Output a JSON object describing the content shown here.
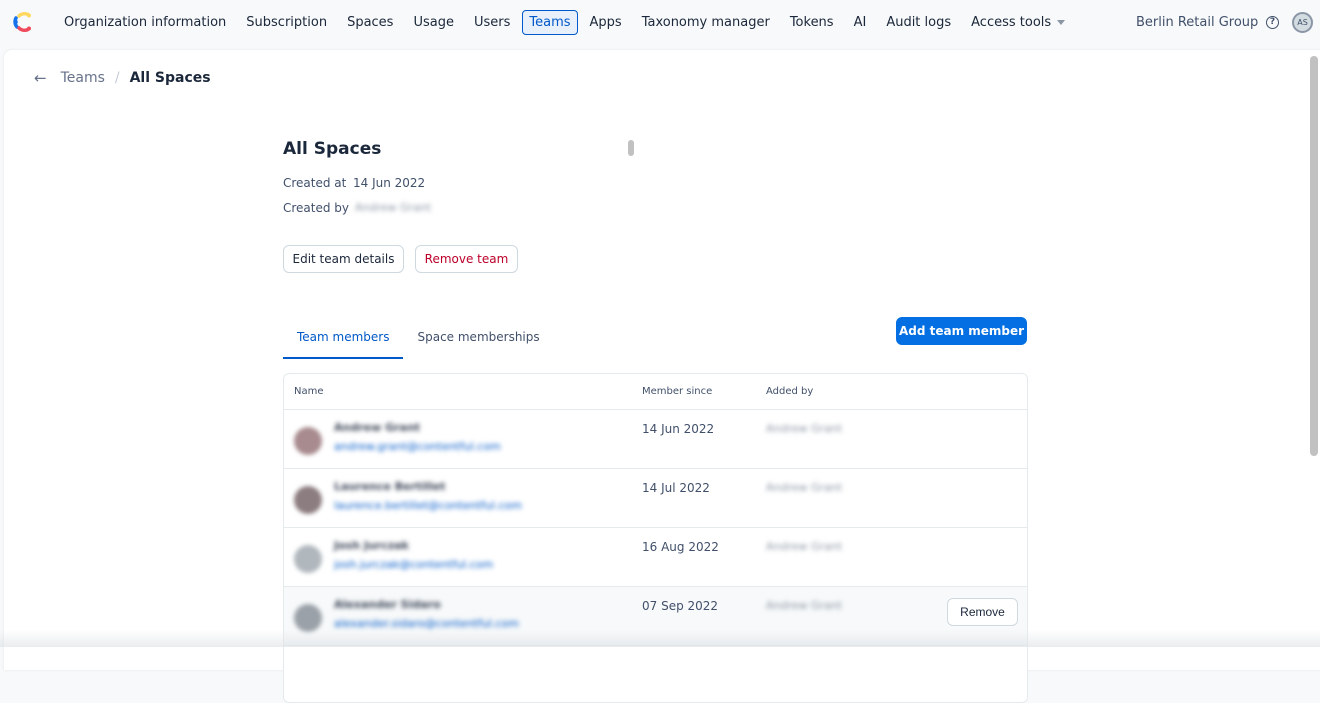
{
  "nav": {
    "items": [
      {
        "label": "Organization information"
      },
      {
        "label": "Subscription"
      },
      {
        "label": "Spaces"
      },
      {
        "label": "Usage"
      },
      {
        "label": "Users"
      },
      {
        "label": "Teams",
        "active": true
      },
      {
        "label": "Apps"
      },
      {
        "label": "Taxonomy manager"
      },
      {
        "label": "Tokens"
      },
      {
        "label": "AI"
      },
      {
        "label": "Audit logs"
      },
      {
        "label": "Access tools"
      }
    ],
    "org_name": "Berlin Retail Group",
    "help_icon": "?",
    "user_initials": "AS"
  },
  "breadcrumb": {
    "back_icon": "←",
    "parent": "Teams",
    "separator": "/",
    "current": "All Spaces"
  },
  "team": {
    "title": "All Spaces",
    "created_at_label": "Created at",
    "created_at": "14 Jun 2022",
    "created_by_label": "Created by",
    "created_by": "Andrew Grant",
    "edit_button": "Edit team details",
    "remove_button": "Remove team"
  },
  "tabs": [
    {
      "label": "Team members",
      "active": true
    },
    {
      "label": "Space memberships"
    }
  ],
  "add_member_button": "Add team member",
  "table": {
    "headers": {
      "name": "Name",
      "member_since": "Member since",
      "added_by": "Added by"
    },
    "rows": [
      {
        "name": "Andrew Grant",
        "email": "andrew.grant@contentful.com",
        "member_since": "14 Jun 2022",
        "added_by": "Andrew Grant"
      },
      {
        "name": "Laurence Bertillet",
        "email": "laurence.bertillet@contentful.com",
        "member_since": "14 Jul 2022",
        "added_by": "Andrew Grant"
      },
      {
        "name": "Josh Jurczak",
        "email": "josh.jurczak@contentful.com",
        "member_since": "16 Aug 2022",
        "added_by": "Andrew Grant"
      },
      {
        "name": "Alexander Sidaro",
        "email": "alexander.sidaro@contentful.com",
        "member_since": "07 Sep 2022",
        "added_by": "Andrew Grant",
        "remove_label": "Remove"
      }
    ]
  },
  "colors": {
    "primary": "#036fe3",
    "active_nav": "#0059c8",
    "danger": "#bd002a"
  }
}
